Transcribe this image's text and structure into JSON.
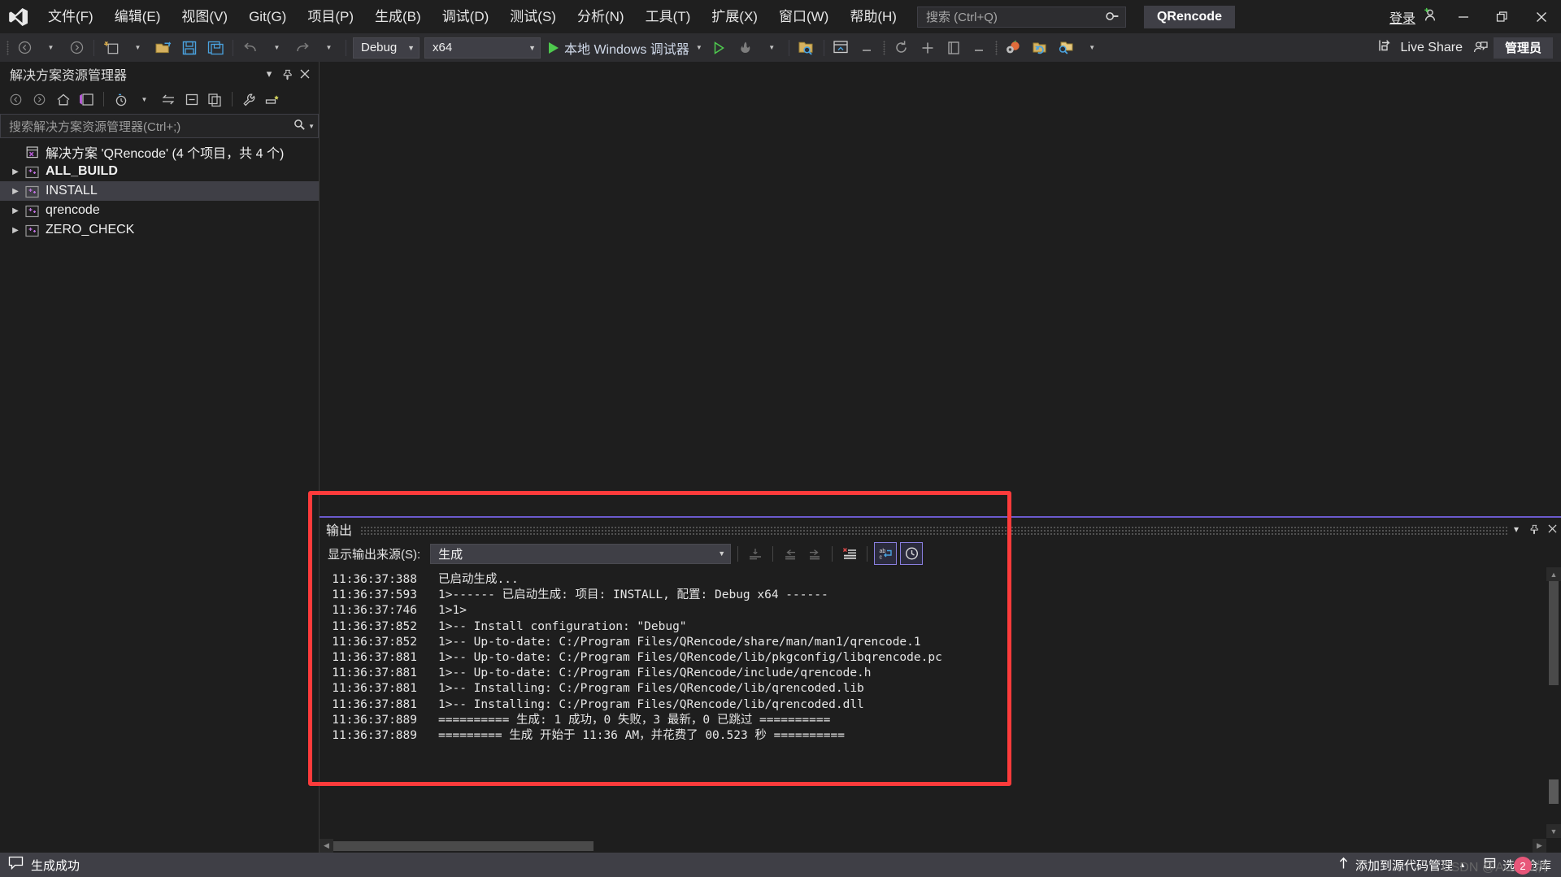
{
  "window": {
    "project_chip": "QRencode",
    "signin_label": "登录",
    "minimize": "—",
    "maximize": "❐",
    "close": "✕"
  },
  "menu": {
    "items": [
      {
        "label": "文件(F)"
      },
      {
        "label": "编辑(E)"
      },
      {
        "label": "视图(V)"
      },
      {
        "label": "Git(G)"
      },
      {
        "label": "项目(P)"
      },
      {
        "label": "生成(B)"
      },
      {
        "label": "调试(D)"
      },
      {
        "label": "测试(S)"
      },
      {
        "label": "分析(N)"
      },
      {
        "label": "工具(T)"
      },
      {
        "label": "扩展(X)"
      },
      {
        "label": "窗口(W)"
      },
      {
        "label": "帮助(H)"
      }
    ]
  },
  "search": {
    "placeholder": "搜索 (Ctrl+Q)",
    "icon": "search-icon"
  },
  "toolbar": {
    "config_value": "Debug",
    "platform_value": "x64",
    "run_label": "本地 Windows 调试器",
    "live_share_label": "Live Share",
    "admin_label": "管理员"
  },
  "solution_explorer": {
    "title": "解决方案资源管理器",
    "search_placeholder": "搜索解决方案资源管理器(Ctrl+;)",
    "root_label": "解决方案 'QRencode' (4 个项目，共 4 个)",
    "items": [
      {
        "label": "ALL_BUILD",
        "bold": true,
        "selected": false
      },
      {
        "label": "INSTALL",
        "bold": false,
        "selected": true
      },
      {
        "label": "qrencode",
        "bold": false,
        "selected": false
      },
      {
        "label": "ZERO_CHECK",
        "bold": false,
        "selected": false
      }
    ]
  },
  "output": {
    "tab_label": "输出",
    "source_label": "显示输出来源(S):",
    "source_value": "生成",
    "lines": [
      {
        "time": "11:36:37:388",
        "text": "已启动生成..."
      },
      {
        "time": "11:36:37:593",
        "text": "1>------ 已启动生成: 项目: INSTALL, 配置: Debug x64 ------"
      },
      {
        "time": "11:36:37:746",
        "text": "1>1>"
      },
      {
        "time": "11:36:37:852",
        "text": "1>-- Install configuration: \"Debug\""
      },
      {
        "time": "11:36:37:852",
        "text": "1>-- Up-to-date: C:/Program Files/QRencode/share/man/man1/qrencode.1"
      },
      {
        "time": "11:36:37:881",
        "text": "1>-- Up-to-date: C:/Program Files/QRencode/lib/pkgconfig/libqrencode.pc"
      },
      {
        "time": "11:36:37:881",
        "text": "1>-- Up-to-date: C:/Program Files/QRencode/include/qrencode.h"
      },
      {
        "time": "11:36:37:881",
        "text": "1>-- Installing: C:/Program Files/QRencode/lib/qrencoded.lib"
      },
      {
        "time": "11:36:37:881",
        "text": "1>-- Installing: C:/Program Files/QRencode/lib/qrencoded.dll"
      },
      {
        "time": "11:36:37:889",
        "text": "========== 生成: 1 成功，0 失败，3 最新，0 已跳过 =========="
      },
      {
        "time": "11:36:37:889",
        "text": "========= 生成 开始于 11:36 AM，并花费了 00.523 秒 =========="
      }
    ]
  },
  "status": {
    "build_result": "生成成功",
    "source_control_label": "添加到源代码管理",
    "repo_label": "选择仓库",
    "watermark": "CSDN @ACE叩牌",
    "watermark_badge": "2"
  },
  "colors": {
    "accent": "#6a5acd",
    "annotation": "#fd3b3b",
    "success_green": "#4ec94e",
    "chip_bg": "#3f3f46"
  }
}
